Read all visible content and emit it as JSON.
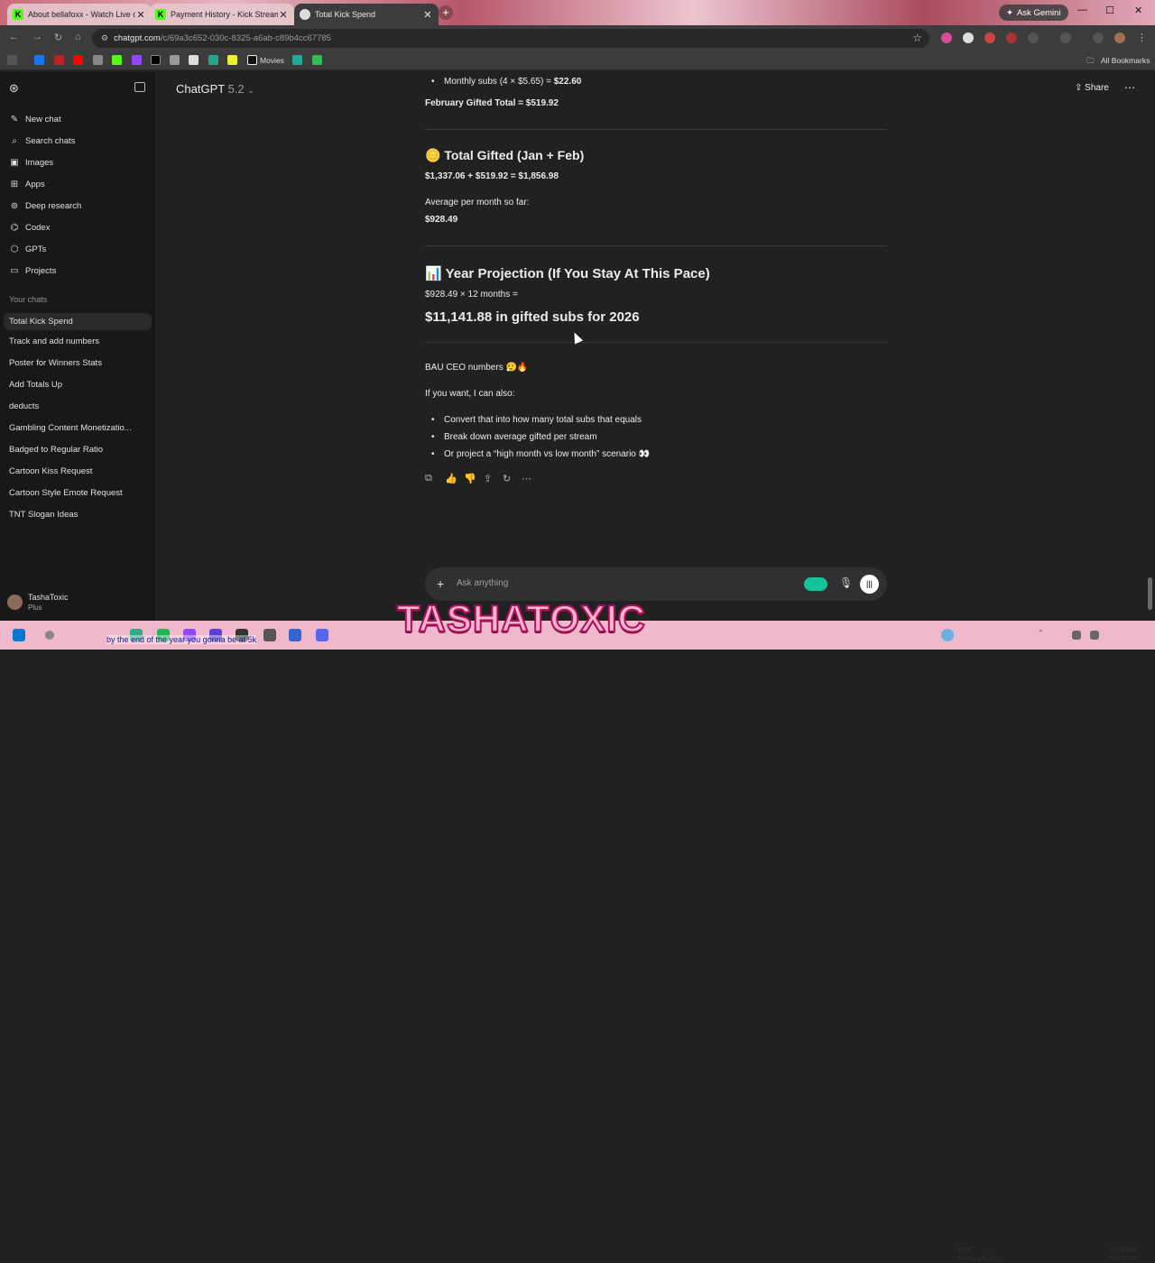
{
  "browser": {
    "tabs": [
      {
        "title": "About bellafoxx - Watch Live on Kick",
        "icon": "kick-icon"
      },
      {
        "title": "Payment History - Kick Streaming",
        "icon": "kick-icon"
      },
      {
        "title": "Total Kick Spend",
        "icon": "chatgpt-icon"
      }
    ],
    "ask_gemini": "Ask Gemini",
    "url_host": "chatgpt.com",
    "url_path": "/c/69a3c652-030c-8325-a6ab-c89b4cc67785",
    "bookmarks": {
      "movies": "Movies",
      "all_bookmarks": "All Bookmarks"
    }
  },
  "sidebar": {
    "nav": [
      {
        "label": "New chat",
        "icon": "new-chat-icon"
      },
      {
        "label": "Search chats",
        "icon": "search-icon"
      },
      {
        "label": "Images",
        "icon": "images-icon"
      },
      {
        "label": "Apps",
        "icon": "apps-icon"
      },
      {
        "label": "Deep research",
        "icon": "deep-research-icon"
      },
      {
        "label": "Codex",
        "icon": "codex-icon"
      },
      {
        "label": "GPTs",
        "icon": "gpts-icon"
      },
      {
        "label": "Projects",
        "icon": "projects-icon"
      }
    ],
    "your_chats_label": "Your chats",
    "chats": [
      "Total Kick Spend",
      "Track and add numbers",
      "Poster for Winners Stats",
      "Add Totals Up",
      "deducts",
      "Gambling Content Monetizatio...",
      "Badged to Regular Ratio",
      "Cartoon Kiss Request",
      "Cartoon Style Emote Request",
      "TNT Slogan Ideas"
    ],
    "user": {
      "name": "TashaToxic",
      "plan": "Plus"
    }
  },
  "header": {
    "model": "ChatGPT",
    "version": "5.2",
    "share": "Share"
  },
  "message": {
    "monthly_subs_prefix": "Monthly subs (4 × $5.65) = ",
    "monthly_subs_value": "$22.60",
    "feb_total": "February Gifted Total = $519.92",
    "total_heading": "🪙 Total Gifted (Jan + Feb)",
    "total_calc": "$1,337.06 + $519.92 = $1,856.98",
    "avg_label": "Average per month so far:",
    "avg_value": "$928.49",
    "proj_heading": "📊 Year Projection (If You Stay At This Pace)",
    "proj_calc": "$928.49 × 12 months =",
    "proj_result": "$11,141.88 in gifted subs for 2026",
    "bau": "BAU CEO numbers 😮‍💨🔥",
    "offer": "If you want, I can also:",
    "options": [
      "Convert that into how many total subs that equals",
      "Break down average gifted per stream",
      "Or project a “high month vs low month” scenario 👀"
    ]
  },
  "composer": {
    "placeholder": "Ask anything"
  },
  "overlay": {
    "watermark": "TASHATOXIC",
    "caption": "by the end of the year you gonna be at 5k"
  },
  "taskbar": {
    "weather_temp": "62°F",
    "weather_desc": "Mostly cloudy",
    "time": "11:58 PM",
    "date": "2/28/2026"
  },
  "colors": {
    "accent_green": "#53fc18",
    "bg": "#212121",
    "sidebar": "#181818"
  }
}
